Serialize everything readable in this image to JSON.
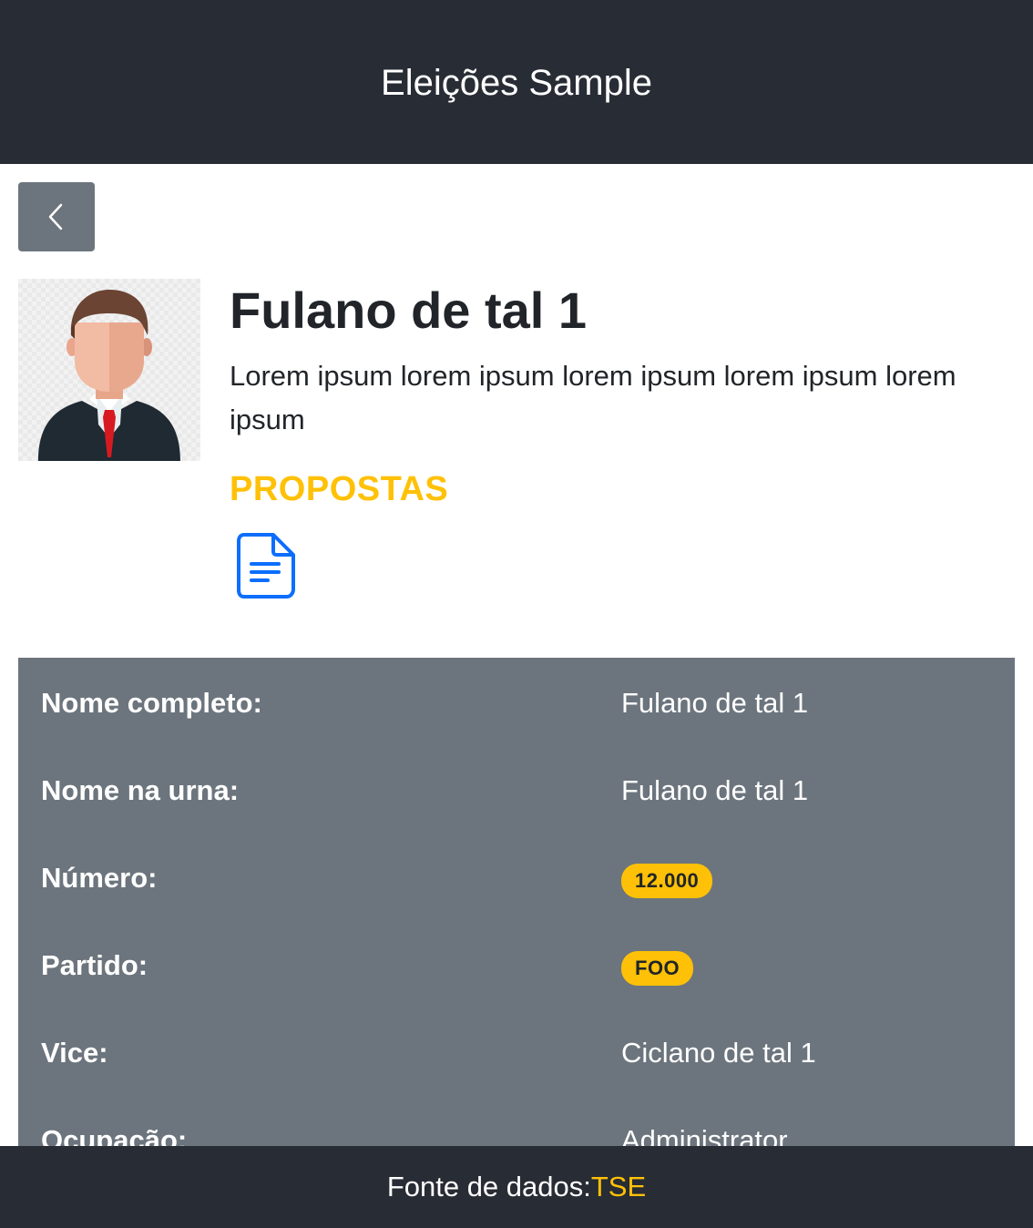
{
  "header": {
    "title": "Eleições Sample"
  },
  "back_button": {
    "icon": "chevron-left-icon"
  },
  "candidate": {
    "photo": "avatar",
    "name": "Fulano de tal 1",
    "bio": "Lorem ipsum lorem ipsum lorem ipsum lorem ipsum lorem ipsum",
    "propostas_label": "PROPOSTAS",
    "propostas_icon": "document-icon"
  },
  "details": [
    {
      "label": "Nome completo:",
      "value": "Fulano de tal 1",
      "type": "text"
    },
    {
      "label": "Nome na urna:",
      "value": "Fulano de tal 1",
      "type": "text"
    },
    {
      "label": "Número:",
      "value": "12.000",
      "type": "badge"
    },
    {
      "label": "Partido:",
      "value": "FOO",
      "type": "badge"
    },
    {
      "label": "Vice:",
      "value": "Ciclano de tal 1",
      "type": "text"
    },
    {
      "label": "Ocupação:",
      "value": "Administrator",
      "type": "text"
    }
  ],
  "footer": {
    "text": "Fonte de dados:",
    "link": "TSE"
  },
  "colors": {
    "header_bg": "#282c35",
    "accent": "#ffc107",
    "panel_bg": "#6c757d",
    "link_blue": "#0d6efd"
  }
}
